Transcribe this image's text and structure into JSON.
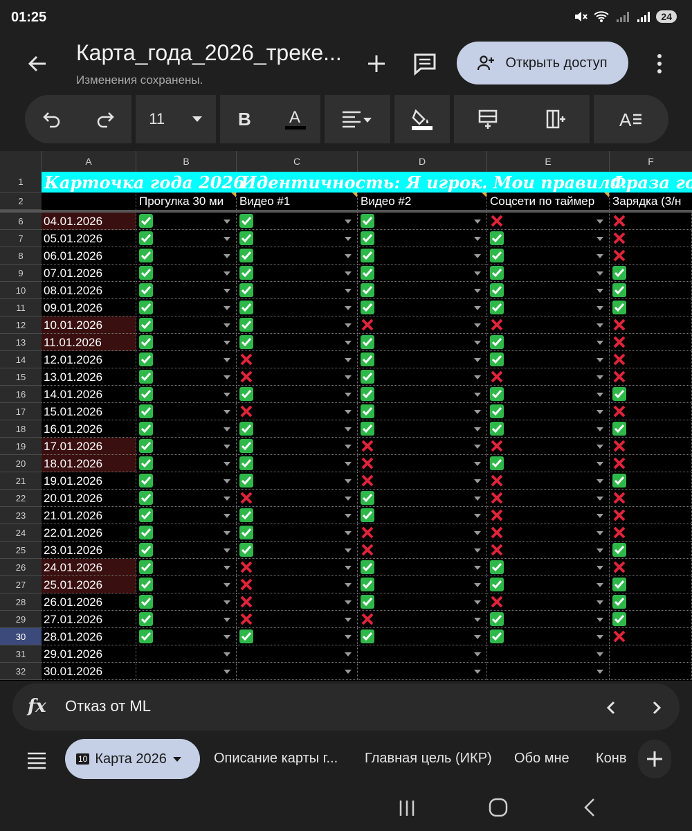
{
  "status_bar": {
    "time": "01:25",
    "battery": "24"
  },
  "header": {
    "title": "Карта_года_2026_треке...",
    "status": "Изменения сохранены.",
    "share_label": "Открыть доступ"
  },
  "toolbar": {
    "font_size": "11"
  },
  "sheet": {
    "columns": [
      "A",
      "B",
      "C",
      "D",
      "E",
      "F"
    ],
    "row1": {
      "number": "1",
      "banner1": "Карточка года 2026",
      "banner2": "Идентичность: Я игрок. Мои правила.",
      "banner3": "Фраза го"
    },
    "row2": {
      "number": "2",
      "headers": [
        "Прогулка 30 ми",
        "Видео #1",
        "Видео #2",
        "Соцсети по таймер",
        "Зарядка (3/н"
      ]
    },
    "rows": [
      {
        "n": "6",
        "date": "04.01.2026",
        "w": true,
        "v": [
          1,
          1,
          1,
          0,
          0
        ]
      },
      {
        "n": "7",
        "date": "05.01.2026",
        "w": false,
        "v": [
          1,
          1,
          1,
          1,
          0
        ]
      },
      {
        "n": "8",
        "date": "06.01.2026",
        "w": false,
        "v": [
          1,
          1,
          1,
          1,
          0
        ]
      },
      {
        "n": "9",
        "date": "07.01.2026",
        "w": false,
        "v": [
          1,
          1,
          1,
          1,
          1
        ]
      },
      {
        "n": "10",
        "date": "08.01.2026",
        "w": false,
        "v": [
          1,
          1,
          1,
          1,
          1
        ]
      },
      {
        "n": "11",
        "date": "09.01.2026",
        "w": false,
        "v": [
          1,
          1,
          1,
          1,
          1
        ]
      },
      {
        "n": "12",
        "date": "10.01.2026",
        "w": true,
        "v": [
          1,
          1,
          0,
          0,
          0
        ]
      },
      {
        "n": "13",
        "date": "11.01.2026",
        "w": true,
        "v": [
          1,
          1,
          1,
          1,
          0
        ]
      },
      {
        "n": "14",
        "date": "12.01.2026",
        "w": false,
        "v": [
          1,
          0,
          1,
          1,
          0
        ]
      },
      {
        "n": "15",
        "date": "13.01.2026",
        "w": false,
        "v": [
          1,
          0,
          1,
          0,
          0
        ]
      },
      {
        "n": "16",
        "date": "14.01.2026",
        "w": false,
        "v": [
          1,
          1,
          1,
          1,
          1
        ]
      },
      {
        "n": "17",
        "date": "15.01.2026",
        "w": false,
        "v": [
          1,
          0,
          1,
          1,
          0
        ]
      },
      {
        "n": "18",
        "date": "16.01.2026",
        "w": false,
        "v": [
          1,
          1,
          1,
          1,
          1
        ]
      },
      {
        "n": "19",
        "date": "17.01.2026",
        "w": true,
        "v": [
          1,
          1,
          0,
          0,
          0
        ]
      },
      {
        "n": "20",
        "date": "18.01.2026",
        "w": true,
        "v": [
          1,
          1,
          0,
          1,
          0
        ]
      },
      {
        "n": "21",
        "date": "19.01.2026",
        "w": false,
        "v": [
          1,
          1,
          0,
          0,
          1
        ]
      },
      {
        "n": "22",
        "date": "20.01.2026",
        "w": false,
        "v": [
          1,
          0,
          1,
          0,
          0
        ]
      },
      {
        "n": "23",
        "date": "21.01.2026",
        "w": false,
        "v": [
          1,
          1,
          1,
          0,
          0
        ]
      },
      {
        "n": "24",
        "date": "22.01.2026",
        "w": false,
        "v": [
          1,
          1,
          0,
          0,
          0
        ]
      },
      {
        "n": "25",
        "date": "23.01.2026",
        "w": false,
        "v": [
          1,
          1,
          0,
          0,
          1
        ]
      },
      {
        "n": "26",
        "date": "24.01.2026",
        "w": true,
        "v": [
          1,
          0,
          1,
          1,
          0
        ]
      },
      {
        "n": "27",
        "date": "25.01.2026",
        "w": true,
        "v": [
          1,
          0,
          1,
          1,
          1
        ]
      },
      {
        "n": "28",
        "date": "26.01.2026",
        "w": false,
        "v": [
          1,
          0,
          1,
          0,
          1
        ]
      },
      {
        "n": "29",
        "date": "27.01.2026",
        "w": false,
        "v": [
          1,
          0,
          0,
          1,
          1
        ]
      },
      {
        "n": "30",
        "date": "28.01.2026",
        "w": false,
        "v": [
          1,
          1,
          1,
          1,
          0
        ],
        "sel": true
      },
      {
        "n": "31",
        "date": "29.01.2026",
        "w": false,
        "v": [
          null,
          null,
          null,
          null,
          null
        ]
      },
      {
        "n": "32",
        "date": "30.01.2026",
        "w": false,
        "v": [
          null,
          null,
          null,
          null,
          null
        ]
      }
    ]
  },
  "formula_bar": {
    "fx": "fx",
    "value": "Отказ от ML"
  },
  "sheet_tabs": {
    "active_badge": "10",
    "active": "Карта 2026",
    "others": [
      "Описание карты г...",
      "Главная цель (ИКР)",
      "Обо мне",
      "Конв"
    ]
  },
  "colors": {
    "accent": "#c5d0e6",
    "cyan": "#00ffff",
    "check_green": "#2fb84a",
    "cross_red": "#e0243a",
    "weekend": "#3a0f0f"
  }
}
